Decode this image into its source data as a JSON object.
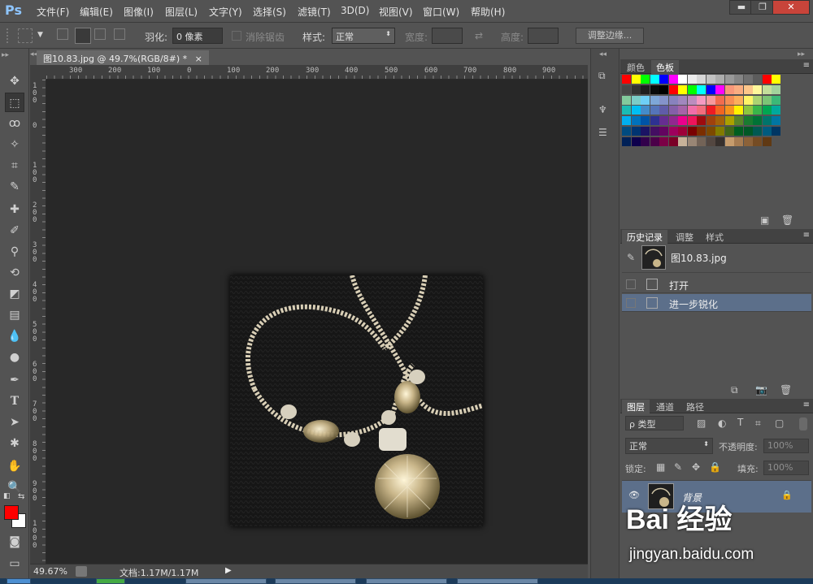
{
  "app": {
    "logo": "Ps",
    "menu": [
      "文件(F)",
      "编辑(E)",
      "图像(I)",
      "图层(L)",
      "文字(Y)",
      "选择(S)",
      "滤镜(T)",
      "3D(D)",
      "视图(V)",
      "窗口(W)",
      "帮助(H)"
    ],
    "window_buttons": [
      "minimize-icon",
      "restore-icon",
      "close-icon"
    ]
  },
  "options": {
    "feather_label": "羽化:",
    "feather_value": "0 像素",
    "antialias_label": "消除锯齿",
    "style_label": "样式:",
    "style_value": "正常",
    "width_label": "宽度:",
    "height_label": "高度:",
    "refine_button": "调整边缘..."
  },
  "document": {
    "tab_title": "图10.83.jpg @ 49.7%(RGB/8#) *",
    "close_glyph": "×",
    "ruler_top": [
      "300",
      "200",
      "100",
      "0",
      "100",
      "200",
      "300",
      "400",
      "500",
      "600",
      "700",
      "800",
      "900"
    ],
    "ruler_left": [
      "100",
      "0",
      "100",
      "200",
      "300",
      "400",
      "500",
      "600",
      "700",
      "800",
      "900",
      "1000"
    ],
    "zoom": "49.67%",
    "doc_size": "文档:1.17M/1.17M"
  },
  "panels": {
    "color_tab": "颜色",
    "swatches_tab": "色板",
    "history_tab": "历史记录",
    "adjust_tab": "调整",
    "styles_tab": "样式",
    "history_snapshot": "图10.83.jpg",
    "history_items": [
      "打开",
      "进一步锐化"
    ],
    "layers_tab": "图层",
    "channels_tab": "通道",
    "paths_tab": "路径",
    "filter_kind": "ρ 类型",
    "blend_mode": "正常",
    "opacity_label": "不透明度:",
    "opacity_value": "100%",
    "lock_label": "锁定:",
    "fill_label": "填充:",
    "fill_value": "100%",
    "layer_name": "背景"
  },
  "swatch_colors": [
    [
      "#ff0000",
      "#ffff00",
      "#00ff00",
      "#00ffff",
      "#0000ff",
      "#ff00ff",
      "#ffffff",
      "#ebebeb",
      "#d6d6d6",
      "#c2c2c2",
      "#adadad",
      "#999999",
      "#858585",
      "#707070",
      "#5c5c5c",
      "#ff0000",
      "#ffff00"
    ],
    [
      "#474747",
      "#333333",
      "#1f1f1f",
      "#0a0a0a",
      "#000000",
      "#ff0000",
      "#ffff00",
      "#00ff00",
      "#00ffff",
      "#0000ff",
      "#ff00ff",
      "#f7977a",
      "#f9ad81",
      "#fdc68a",
      "#fff79a",
      "#c4df9b",
      "#a2d39c"
    ],
    [
      "#82ca9d",
      "#7bcdc8",
      "#6ecff6",
      "#7ea7d8",
      "#8493ca",
      "#8882be",
      "#a187be",
      "#bc8dbf",
      "#f49ac2",
      "#f6989d",
      "#f26c4f",
      "#f68e55",
      "#fbaf5c",
      "#fff467",
      "#acd372",
      "#7cc576",
      "#3bb878"
    ],
    [
      "#1abbb4",
      "#00bff3",
      "#438cca",
      "#5574b9",
      "#605ca8",
      "#855fa8",
      "#a763a8",
      "#f06ea9",
      "#f26d7d",
      "#ed1c24",
      "#f26522",
      "#f7941d",
      "#fff200",
      "#8dc63f",
      "#39b54a",
      "#00a651",
      "#00a99d"
    ],
    [
      "#00aeef",
      "#0072bc",
      "#0054a6",
      "#2e3192",
      "#662d91",
      "#92278f",
      "#ec008c",
      "#ed145b",
      "#9e0b0f",
      "#a0410d",
      "#a36209",
      "#aba000",
      "#598527",
      "#197b30",
      "#007236",
      "#00746b",
      "#0076a3"
    ],
    [
      "#004b80",
      "#003471",
      "#1b1464",
      "#440e62",
      "#630460",
      "#9e005d",
      "#9e0039",
      "#790000",
      "#7b2e00",
      "#7d4900",
      "#827b00",
      "#406618",
      "#005e20",
      "#005826",
      "#005952",
      "#005b7f",
      "#003663"
    ],
    [
      "#002157",
      "#0d004c",
      "#32004b",
      "#4b0049",
      "#7b0046",
      "#7a0026",
      "#c7b299",
      "#998675",
      "#736357",
      "#534741",
      "#37302d",
      "#c69c6d",
      "#a67c52",
      "#8c6239",
      "#754c24",
      "#603913"
    ]
  ],
  "tools": [
    "move-tool-icon",
    "marquee-tool-icon",
    "lasso-tool-icon",
    "magic-wand-icon",
    "crop-tool-icon",
    "eyedropper-icon",
    "healing-brush-icon",
    "brush-tool-icon",
    "clone-stamp-icon",
    "history-brush-icon",
    "eraser-icon",
    "gradient-tool-icon",
    "blur-tool-icon",
    "dodge-tool-icon",
    "pen-tool-icon",
    "type-tool-icon",
    "path-select-icon",
    "shape-tool-icon",
    "hand-tool-icon",
    "zoom-tool-icon"
  ],
  "colors": {
    "foreground": "#ff0000",
    "background": "#ffffff",
    "selection": "#5c6f8a",
    "accent": "#8ec5ff"
  },
  "watermark": {
    "brand": "Bai 经验",
    "url": "jingyan.baidu.com"
  }
}
